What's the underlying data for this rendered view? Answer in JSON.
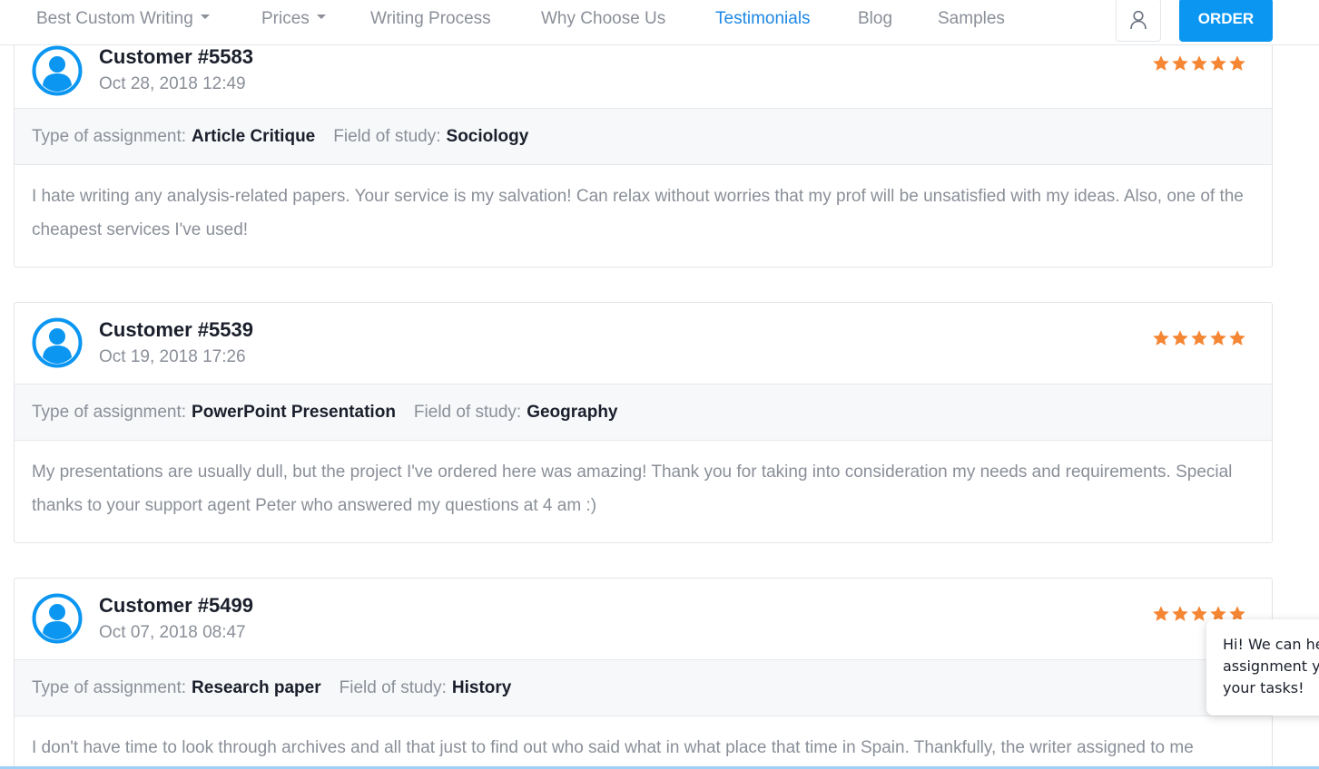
{
  "nav": {
    "items": [
      {
        "label": "Best Custom Writing",
        "dropdown": true,
        "active": false
      },
      {
        "label": "Prices",
        "dropdown": true,
        "active": false
      },
      {
        "label": "Writing Process",
        "dropdown": false,
        "active": false
      },
      {
        "label": "Why Choose Us",
        "dropdown": false,
        "active": false
      },
      {
        "label": "Testimonials",
        "dropdown": false,
        "active": true
      },
      {
        "label": "Blog",
        "dropdown": false,
        "active": false
      },
      {
        "label": "Samples",
        "dropdown": false,
        "active": false
      }
    ],
    "account_icon": "user-icon",
    "order_label": "ORDER"
  },
  "reviews": [
    {
      "customer": "Customer #5583",
      "date": "Oct 28, 2018 12:49",
      "rating": 5,
      "assignment_label": "Type of assignment:",
      "assignment": "Article Critique",
      "field_label": "Field of study:",
      "field": "Sociology",
      "text": "I hate writing any analysis-related papers. Your service is my salvation! Can relax without worries that my prof will be unsatisfied with my ideas. Also, one of the cheapest services I've used!"
    },
    {
      "customer": "Customer #5539",
      "date": "Oct 19, 2018 17:26",
      "rating": 5,
      "assignment_label": "Type of assignment:",
      "assignment": "PowerPoint Presentation",
      "field_label": "Field of study:",
      "field": "Geography",
      "text": "My presentations are usually dull, but the project I've ordered here was amazing! Thank you for taking into consideration my needs and requirements. Special thanks to your support agent Peter who answered my questions at 4 am :)"
    },
    {
      "customer": "Customer #5499",
      "date": "Oct 07, 2018 08:47",
      "rating": 5,
      "assignment_label": "Type of assignment:",
      "assignment": "Research paper",
      "field_label": "Field of study:",
      "field": "History",
      "text": "I don't have time to look through archives and all that just to find out who said what in what place that time in Spain. Thankfully, the writer assigned to me"
    }
  ],
  "chat": {
    "lines": [
      "Hi! We can he",
      "assignment y",
      "your tasks!"
    ]
  },
  "colors": {
    "accent": "#0b96f2",
    "active_nav": "#1e88e5",
    "star": "#f58634",
    "heading": "#1a1f2b",
    "muted": "#8a8f98"
  }
}
